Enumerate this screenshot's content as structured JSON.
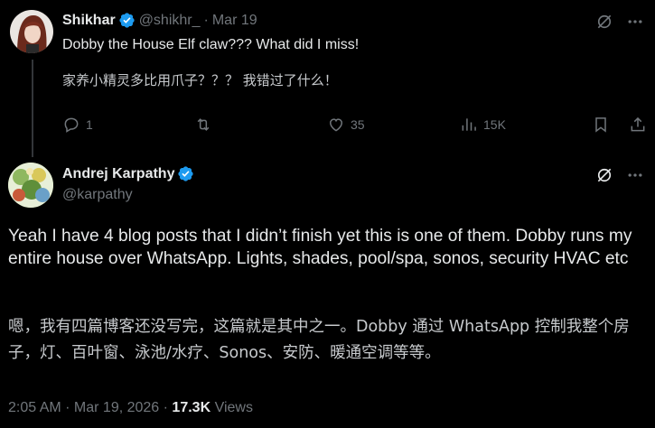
{
  "reply": {
    "name": "Shikhar",
    "handle": "@shikhr_",
    "separator": "·",
    "date": "Mar 19",
    "text_en": "Dobby the House Elf claw??? What did I miss!",
    "text_zh": "家养小精灵多比用爪子？？？ 我错过了什么！",
    "actions": {
      "replies": "1",
      "retweets": "",
      "likes": "35",
      "views": "15K"
    }
  },
  "main": {
    "name": "Andrej Karpathy",
    "handle": "@karpathy",
    "body_en": "Yeah I have 4 blog posts that I didn’t finish yet this is one of them. Dobby runs my entire house over WhatsApp. Lights, shades, pool/spa, sonos, security HVAC etc",
    "body_zh": "嗯，我有四篇博客还没写完，这篇就是其中之一。Dobby 通过 WhatsApp 控制我整个房子，灯、百叶窗、泳池/水疗、Sonos、安防、暖通空调等等。",
    "timestamp": "2:05 AM · Mar 19, 2026 · ",
    "views_count": "17.3K",
    "views_label": " Views"
  },
  "colors": {
    "background": "#000000",
    "text": "#e7e9ea",
    "secondary": "#71767b",
    "verified_blue": "#1d9bf0"
  },
  "icons": [
    "verified-badge-icon",
    "grok-icon",
    "more-icon",
    "reply-icon",
    "retweet-icon",
    "like-icon",
    "views-icon",
    "bookmark-icon",
    "share-icon"
  ]
}
